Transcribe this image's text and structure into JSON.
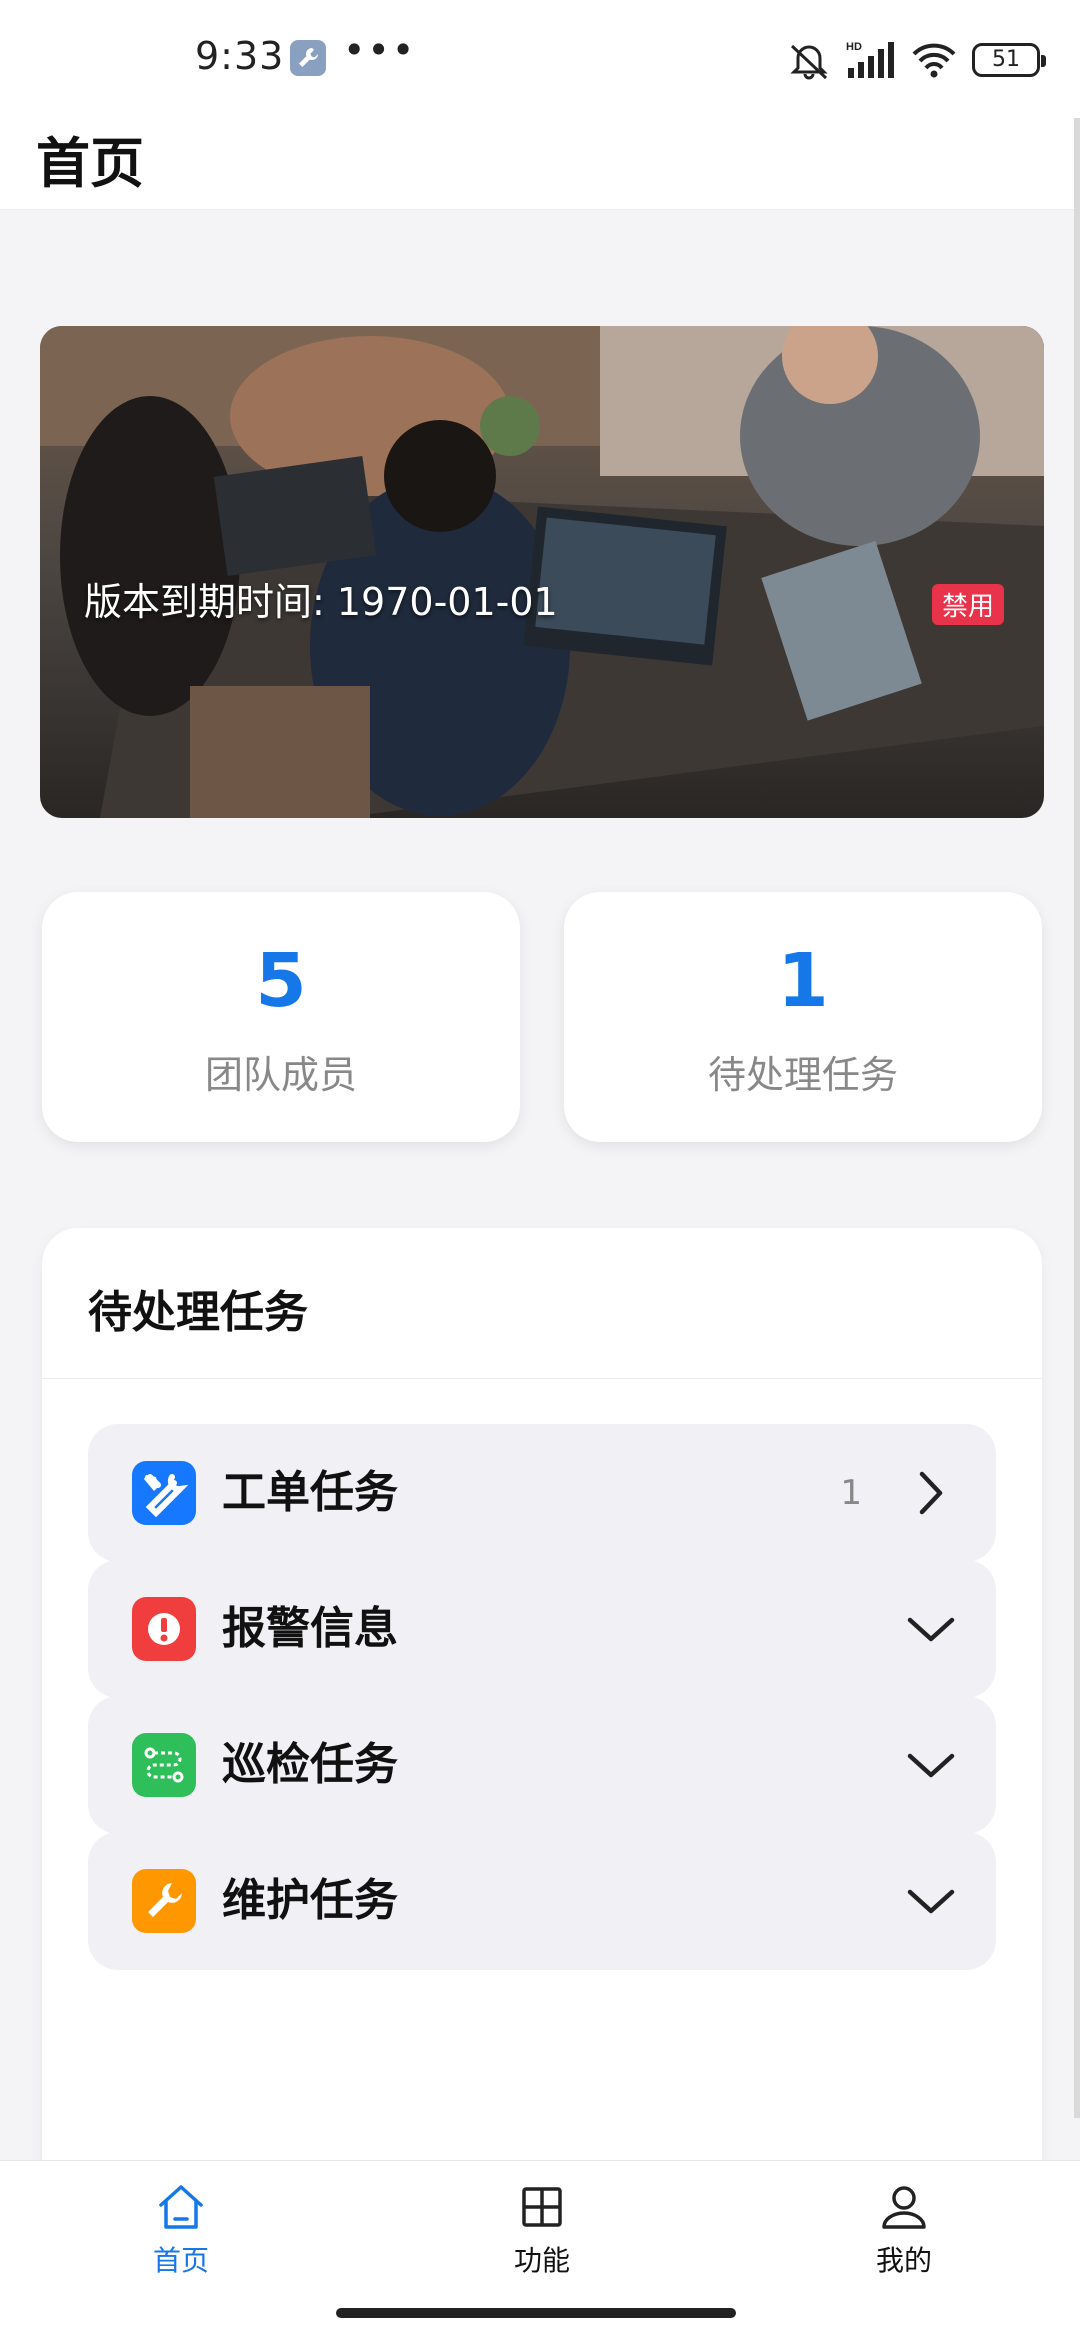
{
  "status_bar": {
    "time": "9:33",
    "dots": "•••",
    "battery": "51",
    "icons": [
      "wrench-app-icon",
      "mute-icon",
      "hd-signal-icon",
      "wifi-icon",
      "battery-icon"
    ]
  },
  "header": {
    "title": "首页"
  },
  "banner": {
    "expiry_text": "版本到期时间: 1970-01-01",
    "badge": "禁用"
  },
  "stats": [
    {
      "value": "5",
      "label": "团队成员"
    },
    {
      "value": "1",
      "label": "待处理任务"
    }
  ],
  "pending": {
    "title": "待处理任务",
    "items": [
      {
        "label": "工单任务",
        "count": "1",
        "icon": "tools-icon",
        "color": "#1677ff",
        "state": "arrow-right"
      },
      {
        "label": "报警信息",
        "count": "",
        "icon": "alert-icon",
        "color": "#f03e3e",
        "state": "chevron-down"
      },
      {
        "label": "巡检任务",
        "count": "",
        "icon": "route-icon",
        "color": "#2fbf5a",
        "state": "chevron-down"
      },
      {
        "label": "维护任务",
        "count": "",
        "icon": "wrench-icon",
        "color": "#ff9800",
        "state": "chevron-down"
      }
    ]
  },
  "nav": {
    "items": [
      {
        "label": "首页",
        "icon": "home-icon",
        "active": true
      },
      {
        "label": "功能",
        "icon": "grid-icon",
        "active": false
      },
      {
        "label": "我的",
        "icon": "user-icon",
        "active": false
      }
    ]
  },
  "colors": {
    "accent": "#1677e8",
    "badge": "#e8334a",
    "background": "#f4f4f6"
  }
}
